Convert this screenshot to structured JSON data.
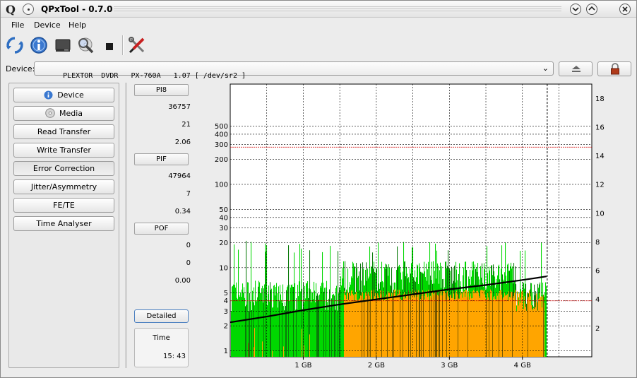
{
  "window": {
    "title": "QPxTool - 0.7.0",
    "app_letter": "Q"
  },
  "menu": [
    "File",
    "Device",
    "Help"
  ],
  "toolbar": {
    "icons": [
      "refresh-icon",
      "info-icon",
      "drive-icon",
      "scan-icon",
      "stop-icon",
      "tools-icon"
    ]
  },
  "device": {
    "label": "Device:",
    "value": "PLEXTOR  DVDR   PX-760A   1.07 [ /dev/sr2 ]",
    "dropdown_arrow": "⌄",
    "eject_icon": "eject-icon",
    "lock_icon": "lock-icon"
  },
  "nav": {
    "buttons": [
      {
        "label": "Device",
        "icon": "info-icon"
      },
      {
        "label": "Media",
        "icon": "disc-icon"
      },
      {
        "label": "Read Transfer"
      },
      {
        "label": "Write Transfer"
      },
      {
        "label": "Error Correction"
      },
      {
        "label": "Jitter/Asymmetry"
      },
      {
        "label": "FE/TE"
      },
      {
        "label": "Time Analyser"
      }
    ],
    "active": "Error Correction"
  },
  "stats": {
    "pi8": {
      "header": "PI8",
      "values": [
        "36757",
        "21",
        "2.06"
      ]
    },
    "pif": {
      "header": "PIF",
      "values": [
        "47964",
        "7",
        "0.34"
      ]
    },
    "pof": {
      "header": "POF",
      "values": [
        "0",
        "0",
        "0.00"
      ]
    },
    "detailed_label": "Detailed",
    "time_label": "Time",
    "time_value": "15: 43"
  },
  "colors": {
    "pi8": "#00d800",
    "pi8_dark": "#0a7a0a",
    "pif": "#ffa500",
    "pif_dark": "#7a5a00",
    "speed": "#000000",
    "limit": "#d00000",
    "grid": "#000000"
  },
  "chart_data": {
    "type": "bar",
    "title": "",
    "xlabel": "",
    "ylabel": "",
    "x_unit": "GB",
    "xlim": [
      0,
      4.95
    ],
    "x_ticks": [
      1,
      2,
      3,
      4
    ],
    "x_tick_labels": [
      "1 GB",
      "2 GB",
      "3 GB",
      "4 GB"
    ],
    "y_left_scale": "log",
    "y_left_ticks": [
      1,
      2,
      3,
      4,
      5,
      10,
      20,
      30,
      40,
      50,
      100,
      200,
      300,
      400,
      500
    ],
    "y_right_ticks": [
      2,
      4,
      6,
      8,
      10,
      12,
      14,
      16,
      18
    ],
    "y_right_lim": [
      0,
      19
    ],
    "data_end": 4.33,
    "limit_lines": [
      280,
      4
    ],
    "series": [
      {
        "name": "",
        "kind": "pi8",
        "approx_peak": 21
      },
      {
        "name": "",
        "kind": "pif",
        "approx_peak": 7
      },
      {
        "name": "",
        "kind": "speed",
        "x": [
          0,
          0.5,
          1.0,
          1.5,
          2.0,
          2.5,
          3.0,
          3.5,
          4.0,
          4.33
        ],
        "y": [
          2.4,
          2.8,
          3.25,
          3.65,
          4.0,
          4.35,
          4.7,
          5.0,
          5.35,
          5.6
        ]
      }
    ]
  }
}
